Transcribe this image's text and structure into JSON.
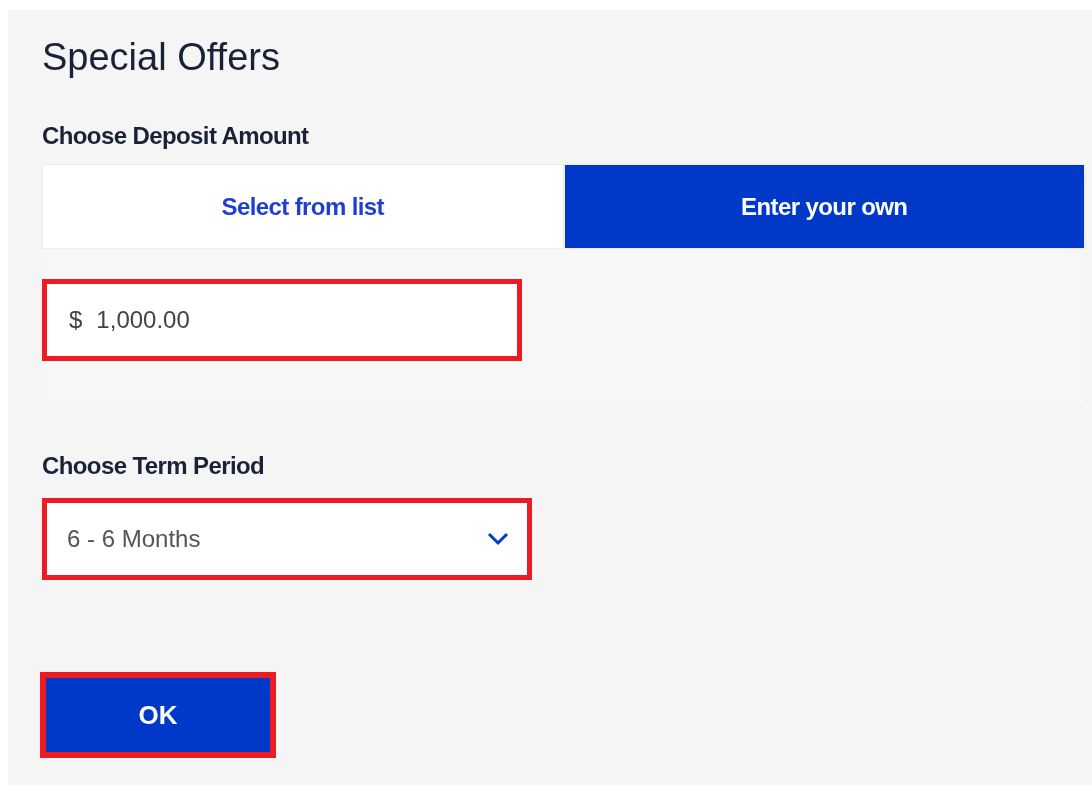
{
  "title": "Special Offers",
  "deposit": {
    "label": "Choose Deposit Amount",
    "tabs": [
      {
        "label": "Select from list",
        "selected": false
      },
      {
        "label": "Enter your own",
        "selected": true
      }
    ],
    "amount": {
      "prefix": "$",
      "value": "1,000.00",
      "highlighted": true
    }
  },
  "term": {
    "label": "Choose Term Period",
    "value": "6 - 6 Months",
    "highlighted": true
  },
  "ok_button": {
    "label": "OK",
    "highlighted": true
  }
}
